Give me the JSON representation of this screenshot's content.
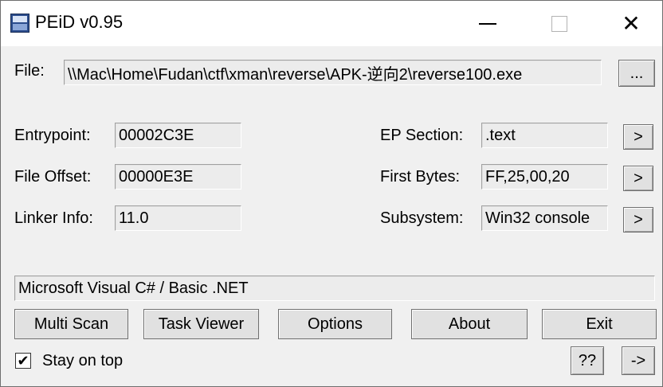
{
  "window": {
    "title": "PEiD v0.95",
    "icon": "peid-app-icon"
  },
  "titlebar": {
    "minimize_icon": "minimize-icon",
    "maximize_icon": "maximize-icon",
    "close_symbol": "✕"
  },
  "file": {
    "label": "File:",
    "path": "\\\\Mac\\Home\\Fudan\\ctf\\xman\\reverse\\APK-逆向2\\reverse100.exe",
    "browse_label": "..."
  },
  "fields": {
    "entrypoint": {
      "label": "Entrypoint:",
      "value": "00002C3E"
    },
    "file_offset": {
      "label": "File Offset:",
      "value": "00000E3E"
    },
    "linker_info": {
      "label": "Linker Info:",
      "value": "11.0"
    },
    "ep_section": {
      "label": "EP Section:",
      "value": ".text",
      "button": ">"
    },
    "first_bytes": {
      "label": "First Bytes:",
      "value": "FF,25,00,20",
      "button": ">"
    },
    "subsystem": {
      "label": "Subsystem:",
      "value": "Win32 console",
      "button": ">"
    }
  },
  "result": "Microsoft Visual C# / Basic .NET",
  "buttons": {
    "multi_scan": "Multi Scan",
    "task_viewer": "Task Viewer",
    "options": "Options",
    "about": "About",
    "exit": "Exit",
    "help": "??",
    "next": "->"
  },
  "stay_on_top": {
    "label": "Stay on top",
    "checked": true,
    "check_mark": "✔"
  }
}
